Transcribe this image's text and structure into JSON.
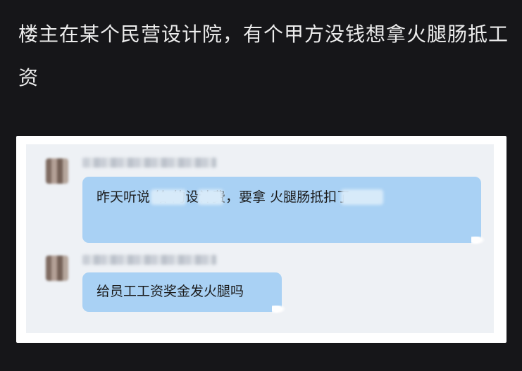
{
  "post": {
    "title": "楼主在某个民营设计院，有个甲方没钱想拿火腿肠抵工资"
  },
  "chat": {
    "messages": [
      {
        "text": "昨天听说        给        的设计费，要拿       火腿肠抵扣了"
      },
      {
        "text": "给员工工资奖金发火腿吗"
      }
    ]
  }
}
